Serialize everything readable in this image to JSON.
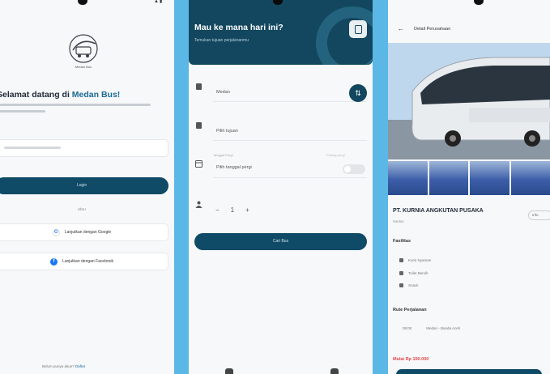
{
  "screen1": {
    "brand_caption": "Medan Bus",
    "welcome_prefix": "Selamat datang di ",
    "welcome_highlight": "Medan Bus!",
    "login_button": "Login",
    "divider": "atau",
    "google_button": "Lanjutkan dengan Google",
    "facebook_button": "Lanjutkan dengan Facebook",
    "footer_text": "Belum punya akun? ",
    "footer_link": "Daftar"
  },
  "screen2": {
    "title": "Mau ke mana hari ini?",
    "subtitle": "Temukan tujuan perjalananmu",
    "from_value": "Medan",
    "to_value": "Pilih tujuan",
    "date_label": "Tanggal Pergi",
    "date_value": "Pilih tanggal pergi",
    "roundtrip_label": "Pulang-pergi",
    "stepper_minus": "−",
    "stepper_value": "1",
    "stepper_plus": "+",
    "search_button": "Cari Bus"
  },
  "screen3": {
    "back_icon": "←",
    "title": "Detail Perusahaan",
    "company_name": "PT. KURNIA ANGKUTAN PUSAKA",
    "company_sub": "Medan",
    "badge": "Info",
    "facilities_title": "Fasilitas",
    "facilities": [
      "Kursi Nyaman",
      "Toilet Bersih",
      "Snack"
    ],
    "route_title": "Rute Perjalanan",
    "route_time": "08:00",
    "route_text": "Medan - Banda Aceh",
    "price": "Mulai Rp 150.000"
  },
  "colors": {
    "primary": "#0f4a66",
    "accent_bg": "#5bb8e6",
    "highlight": "#1b6a96",
    "price": "#e04848"
  }
}
